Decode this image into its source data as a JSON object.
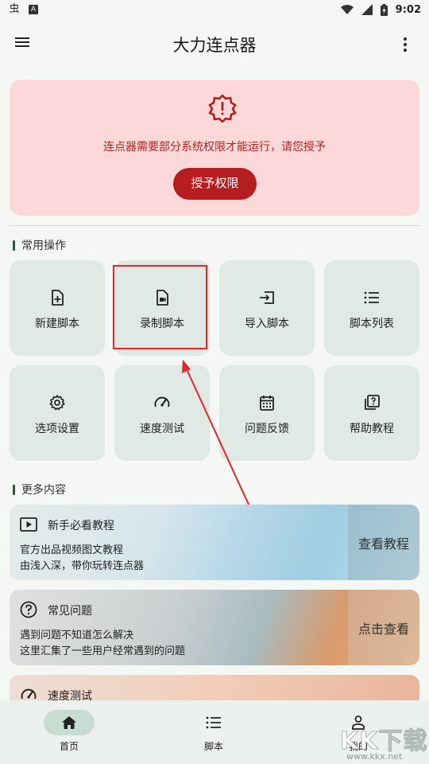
{
  "status_bar": {
    "left_icons": [
      "app-notification-icon",
      "android-app-icon"
    ],
    "time": "9:02",
    "right_icons": [
      "wifi-icon",
      "signal-icon",
      "battery-icon"
    ],
    "left_glyph": "虫",
    "box_glyph": "A"
  },
  "app_bar": {
    "title": "大力连点器"
  },
  "permission_card": {
    "message": "连点器需要部分系统权限才能运行，请您授予",
    "button_label": "授予权限",
    "bg_color": "#fcd9d8",
    "accent_color": "#b51d20"
  },
  "common_section": {
    "title": "常用操作",
    "tiles": [
      {
        "label": "新建脚本",
        "icon": "add-file-icon"
      },
      {
        "label": "录制脚本",
        "icon": "record-file-icon"
      },
      {
        "label": "导入脚本",
        "icon": "import-icon"
      },
      {
        "label": "脚本列表",
        "icon": "list-icon"
      },
      {
        "label": "选项设置",
        "icon": "gear-icon"
      },
      {
        "label": "速度测试",
        "icon": "speedometer-icon"
      },
      {
        "label": "问题反馈",
        "icon": "calendar-icon"
      },
      {
        "label": "帮助教程",
        "icon": "help-icon"
      }
    ]
  },
  "more_section": {
    "title": "更多内容",
    "cards": [
      {
        "title": "新手必看教程",
        "line1": "官方出品视频图文教程",
        "line2": "由浅入深，带你玩转连点器",
        "action": "查看教程",
        "icon": "play-video-icon"
      },
      {
        "title": "常见问题",
        "line1": "遇到问题不知道怎么解决",
        "line2": "这里汇集了一些用户经常遇到的问题",
        "action": "点击查看",
        "icon": "question-icon"
      },
      {
        "title": "速度测试",
        "icon": "speedometer-icon"
      }
    ]
  },
  "bottom_nav": {
    "items": [
      {
        "label": "首页",
        "icon": "home-icon",
        "selected": true
      },
      {
        "label": "脚本",
        "icon": "list-icon",
        "selected": false
      },
      {
        "label": "我的",
        "icon": "person-icon",
        "selected": false
      }
    ]
  },
  "watermark": {
    "brand": "KK下载",
    "url": "www.kkx.net"
  }
}
